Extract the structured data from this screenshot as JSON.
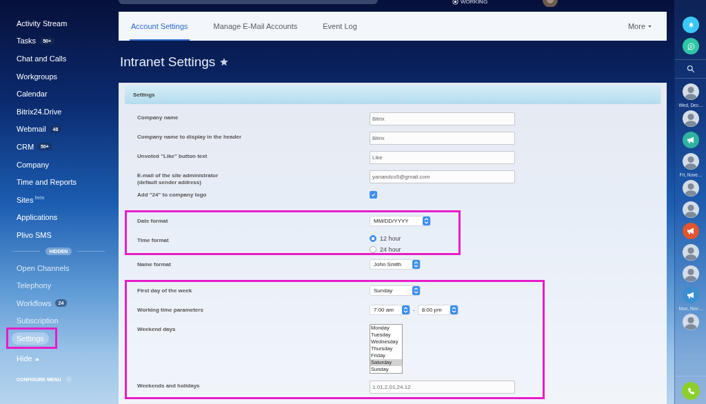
{
  "top_bar": {
    "status": "WORKING"
  },
  "sidebar": {
    "items": [
      {
        "label": "Activity Stream",
        "selected": false
      },
      {
        "label": "Tasks",
        "counter": "50+",
        "selected": false
      },
      {
        "label": "Chat and Calls",
        "selected": false
      },
      {
        "label": "Workgroups",
        "selected": false
      },
      {
        "label": "Calendar",
        "selected": false
      },
      {
        "label": "Bitrix24.Drive",
        "selected": false
      },
      {
        "label": "Webmail",
        "counter": "48",
        "selected": false
      },
      {
        "label": "CRM",
        "counter": "50+",
        "selected": false
      },
      {
        "label": "Company",
        "selected": false
      },
      {
        "label": "Time and Reports",
        "selected": false
      },
      {
        "label": "Sites",
        "superscript": "beta",
        "selected": false
      },
      {
        "label": "Applications",
        "selected": false
      },
      {
        "label": "Plivo SMS",
        "selected": false
      }
    ],
    "hidden_label": "HIDDEN",
    "hidden_items": [
      {
        "label": "Open Channels",
        "selected": false,
        "highlighted": false
      },
      {
        "label": "Telephony",
        "selected": false,
        "highlighted": false
      },
      {
        "label": "Workflows",
        "counter": "24",
        "selected": false,
        "highlighted": false
      },
      {
        "label": "Subscription",
        "selected": false,
        "highlighted": false
      },
      {
        "label": "Settings",
        "selected": true,
        "highlighted": true
      }
    ],
    "hide_toggle": "Hide",
    "configure_menu": "CONFIGURE MENU"
  },
  "tabs": [
    {
      "label": "Account Settings",
      "selected": true
    },
    {
      "label": "Manage E-Mail Accounts",
      "selected": false
    },
    {
      "label": "Event Log",
      "selected": false
    }
  ],
  "more": "More",
  "page_title": "Intranet Settings",
  "settings": {
    "title": "Settings",
    "groups": [
      {
        "highlighted": false,
        "rows": [
          {
            "kind": "text",
            "label": "Company name",
            "value": "Bitrix"
          },
          {
            "kind": "text",
            "label": "Company name to display in the header",
            "value": "Bitrix"
          },
          {
            "kind": "text",
            "label": "Unvoted \"Like\" button text",
            "value": "Like"
          },
          {
            "kind": "text",
            "label": "E-mail of the site administrator\n(default sender address)",
            "value": "yanandco5@gmail.com"
          },
          {
            "kind": "checkbox",
            "label": "Add \"24\" to company logo",
            "checked": true
          }
        ]
      },
      {
        "highlighted": true,
        "rows": [
          {
            "kind": "select",
            "label": "Date format",
            "value": "MM/DD/YYYY"
          },
          {
            "kind": "radio",
            "label": "Time format",
            "options": [
              {
                "label": "12 hour",
                "selected": true
              },
              {
                "label": "24 hour",
                "selected": false
              }
            ]
          }
        ]
      },
      {
        "highlighted": false,
        "rows": [
          {
            "kind": "select",
            "label": "Name format",
            "value": "John Smith"
          }
        ]
      },
      {
        "highlighted": true,
        "rows": [
          {
            "kind": "select",
            "label": "First day of the week",
            "value": "Sunday"
          },
          {
            "kind": "time_range",
            "label": "Working time parameters",
            "from": "7:00 am",
            "separator": "-",
            "to": "8:00 pm"
          },
          {
            "kind": "listbox",
            "label": "Weekend days",
            "options": [
              {
                "label": "Monday",
                "selected": false
              },
              {
                "label": "Tuesday",
                "selected": false
              },
              {
                "label": "Wednesday",
                "selected": false
              },
              {
                "label": "Thursday",
                "selected": false
              },
              {
                "label": "Friday",
                "selected": false
              },
              {
                "label": "Saturday",
                "selected": true
              },
              {
                "label": "Sunday",
                "selected": false
              }
            ]
          },
          {
            "kind": "text",
            "label": "Weekends and holidays",
            "value": "1.01,2.01,24.12"
          }
        ]
      }
    ]
  },
  "right_bar": {
    "items": [
      {
        "kind": "bell",
        "color": "#3bc8f5"
      },
      {
        "kind": "chat",
        "color": "#2fc6a5"
      },
      {
        "kind": "search"
      },
      {
        "kind": "avatar"
      },
      {
        "kind": "date",
        "label": "Wed, Dec…"
      },
      {
        "kind": "avatar"
      },
      {
        "kind": "megaphone",
        "color": "#2fb3a0"
      },
      {
        "kind": "avatar"
      },
      {
        "kind": "date",
        "label": "Fri, Nove…"
      },
      {
        "kind": "avatar"
      },
      {
        "kind": "avatar"
      },
      {
        "kind": "megaphone",
        "color": "#e2552e"
      },
      {
        "kind": "avatar"
      },
      {
        "kind": "avatar"
      },
      {
        "kind": "megaphone",
        "color": "#3a8fd0"
      },
      {
        "kind": "date",
        "label": "Mon, Nov…"
      },
      {
        "kind": "avatar"
      },
      {
        "kind": "phone",
        "color": "#8ccf2c"
      }
    ]
  }
}
